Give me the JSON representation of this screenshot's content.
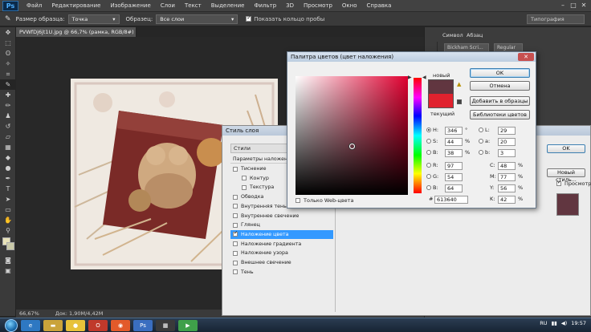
{
  "app": {
    "logo": "Ps"
  },
  "menu": [
    "Файл",
    "Редактирование",
    "Изображение",
    "Слои",
    "Текст",
    "Выделение",
    "Фильтр",
    "3D",
    "Просмотр",
    "Окно",
    "Справка"
  ],
  "options": {
    "sample_size_label": "Размер образца:",
    "sample_size_value": "Точка",
    "sample_label": "Образец:",
    "sample_value": "Все слои",
    "show_ring_label": "Показать кольцо пробы",
    "workspace": "Типография"
  },
  "document": {
    "tab": "PVWfDj6jt1U.jpg @ 66,7% (рамка, RGB/8#) *"
  },
  "status": {
    "zoom": "66,67%",
    "doc": "Док: 1,90M/4,42M"
  },
  "panels": {
    "tabs": [
      "Символ",
      "Абзац"
    ],
    "font_family": "Bickham Scri...",
    "font_style": "Regular"
  },
  "layer_style": {
    "title": "Стиль слоя",
    "header": "Стили",
    "blend_options": "Параметры наложения: По умолчанию",
    "items": [
      {
        "label": "Тиснение",
        "checked": false,
        "indent": false,
        "selected": false
      },
      {
        "label": "Контур",
        "checked": false,
        "indent": true,
        "selected": false
      },
      {
        "label": "Текстура",
        "checked": false,
        "indent": true,
        "selected": false
      },
      {
        "label": "Обводка",
        "checked": false,
        "indent": false,
        "selected": false
      },
      {
        "label": "Внутренняя тень",
        "checked": false,
        "indent": false,
        "selected": false
      },
      {
        "label": "Внутреннее свечение",
        "checked": false,
        "indent": false,
        "selected": false
      },
      {
        "label": "Глянец",
        "checked": false,
        "indent": false,
        "selected": false
      },
      {
        "label": "Наложение цвета",
        "checked": true,
        "indent": false,
        "selected": true
      },
      {
        "label": "Наложение градиента",
        "checked": false,
        "indent": false,
        "selected": false
      },
      {
        "label": "Наложение узора",
        "checked": false,
        "indent": false,
        "selected": false
      },
      {
        "label": "Внешнее свечение",
        "checked": false,
        "indent": false,
        "selected": false
      },
      {
        "label": "Тень",
        "checked": false,
        "indent": false,
        "selected": false
      }
    ],
    "ok": "OK",
    "new_style": "Новый стиль...",
    "preview": "Просмотр"
  },
  "color_picker": {
    "title": "Палитра цветов (цвет наложения)",
    "new_label": "новый",
    "current_label": "текущий",
    "new_color": "#613640",
    "current_color": "#e0222e",
    "buttons": {
      "ok": "OK",
      "cancel": "Отмена",
      "add_swatch": "Добавить в образцы",
      "libraries": "Библиотеки цветов"
    },
    "web_only": "Только Web-цвета",
    "H": {
      "label": "H:",
      "value": "346",
      "unit": "°"
    },
    "S": {
      "label": "S:",
      "value": "44",
      "unit": "%"
    },
    "B": {
      "label": "B:",
      "value": "38",
      "unit": "%"
    },
    "R": {
      "label": "R:",
      "value": "97"
    },
    "G": {
      "label": "G:",
      "value": "54"
    },
    "Bl": {
      "label": "B:",
      "value": "64"
    },
    "L": {
      "label": "L:",
      "value": "29"
    },
    "a": {
      "label": "a:",
      "value": "20"
    },
    "b": {
      "label": "b:",
      "value": "3"
    },
    "C": {
      "label": "C:",
      "value": "48",
      "unit": "%"
    },
    "M": {
      "label": "M:",
      "value": "77",
      "unit": "%"
    },
    "Y": {
      "label": "Y:",
      "value": "56",
      "unit": "%"
    },
    "K": {
      "label": "K:",
      "value": "42",
      "unit": "%"
    },
    "hex_label": "#",
    "hex": "613640"
  },
  "taskbar": {
    "lang": "RU",
    "time": "19:57"
  }
}
